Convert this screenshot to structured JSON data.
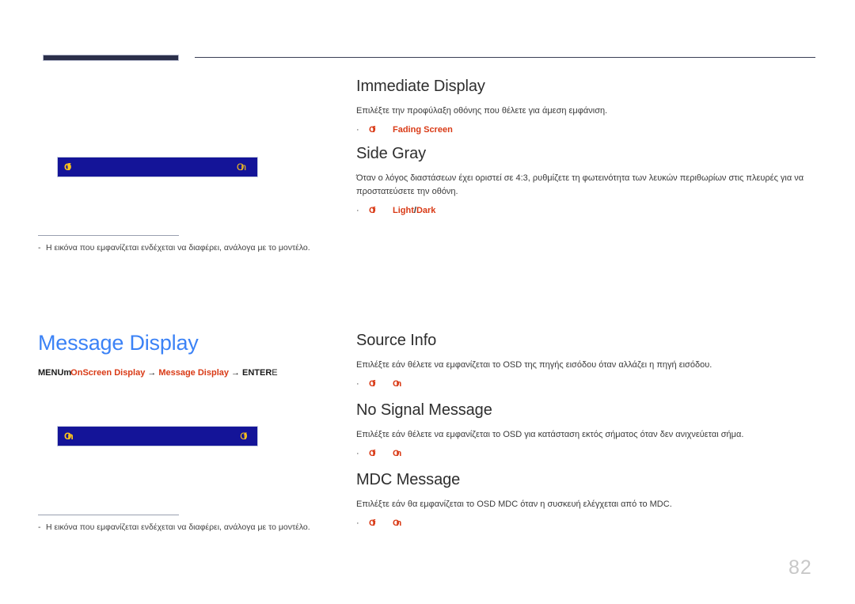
{
  "page": {
    "number": "82"
  },
  "blocks": [
    {
      "id": "immediate-display",
      "heading": "Immediate Display",
      "description": "Επιλέξτε την προφύλαξη οθόνης που θέλετε για άμεση εμφάνιση.",
      "options": [
        {
          "tofu": "Off",
          "label": "Fading Screen",
          "separator": "",
          "label2": ""
        }
      ]
    },
    {
      "id": "side-gray",
      "heading": "Side Gray",
      "description": "Όταν ο λόγος διαστάσεων έχει οριστεί σε 4:3, ρυθμίζετε τη φωτεινότητα των λευκών περιθωρίων στις πλευρές για να προστατεύσετε την οθόνη.",
      "options": [
        {
          "tofu": "Off",
          "label": "Light",
          "separator": "/",
          "label2": "Dark"
        }
      ]
    },
    {
      "id": "source-info",
      "heading": "Source Info",
      "description": "Επιλέξτε εάν θέλετε να εμφανίζεται το OSD της πηγής εισόδου όταν αλλάζει η πηγή εισόδου.",
      "options": [
        {
          "tofu": "Off",
          "label": "",
          "separator": "",
          "label2": "",
          "tofu2": "On"
        }
      ]
    },
    {
      "id": "no-signal-message",
      "heading": "No Signal Message",
      "description": "Επιλέξτε εάν θέλετε να εμφανίζεται το OSD για κατάσταση εκτός σήματος όταν δεν ανιχνεύεται σήμα.",
      "options": [
        {
          "tofu": "Off",
          "label": "",
          "separator": "",
          "label2": "",
          "tofu2": "On"
        }
      ]
    },
    {
      "id": "mdc-message",
      "heading": "MDC Message",
      "description": "Επιλέξτε εάν θα εμφανίζεται το OSD MDC όταν η συσκευή ελέγχεται από το MDC.",
      "options": [
        {
          "tofu": "Off",
          "label": "",
          "separator": "",
          "label2": "",
          "tofu2": "On"
        }
      ]
    }
  ],
  "left_panels": [
    {
      "id": "screen-protection-preview",
      "osd_left_glyph": "Off",
      "osd_right_glyph": "On",
      "footnote": "Η εικόνα που εμφανίζεται ενδέχεται να διαφέρει, ανάλογα με το μοντέλο.",
      "footnote_dash": "-"
    },
    {
      "id": "message-display-preview",
      "osd_left_glyph": "On",
      "osd_right_glyph": "Off",
      "footnote": "Η εικόνα που εμφανίζεται ενδέχεται να διαφέρει, ανάλογα με το μοντέλο.",
      "footnote_dash": "-"
    }
  ],
  "section": {
    "title": "Message Display",
    "breadcrumb": {
      "menu_label": "MENU",
      "menu_tofu": "m",
      "arrow": "→",
      "path1": "OnScreen Display",
      "path2": "Message Display",
      "enter_label": "ENTER",
      "enter_tail": "E"
    }
  },
  "colors": {
    "accent_blue": "#3b82f6",
    "accent_red": "#d93a16",
    "osd_navy": "#141498",
    "osd_yellow": "#ffc61a",
    "rule_navy": "#2b2f4a",
    "page_number_gray": "#c8c8c8"
  }
}
